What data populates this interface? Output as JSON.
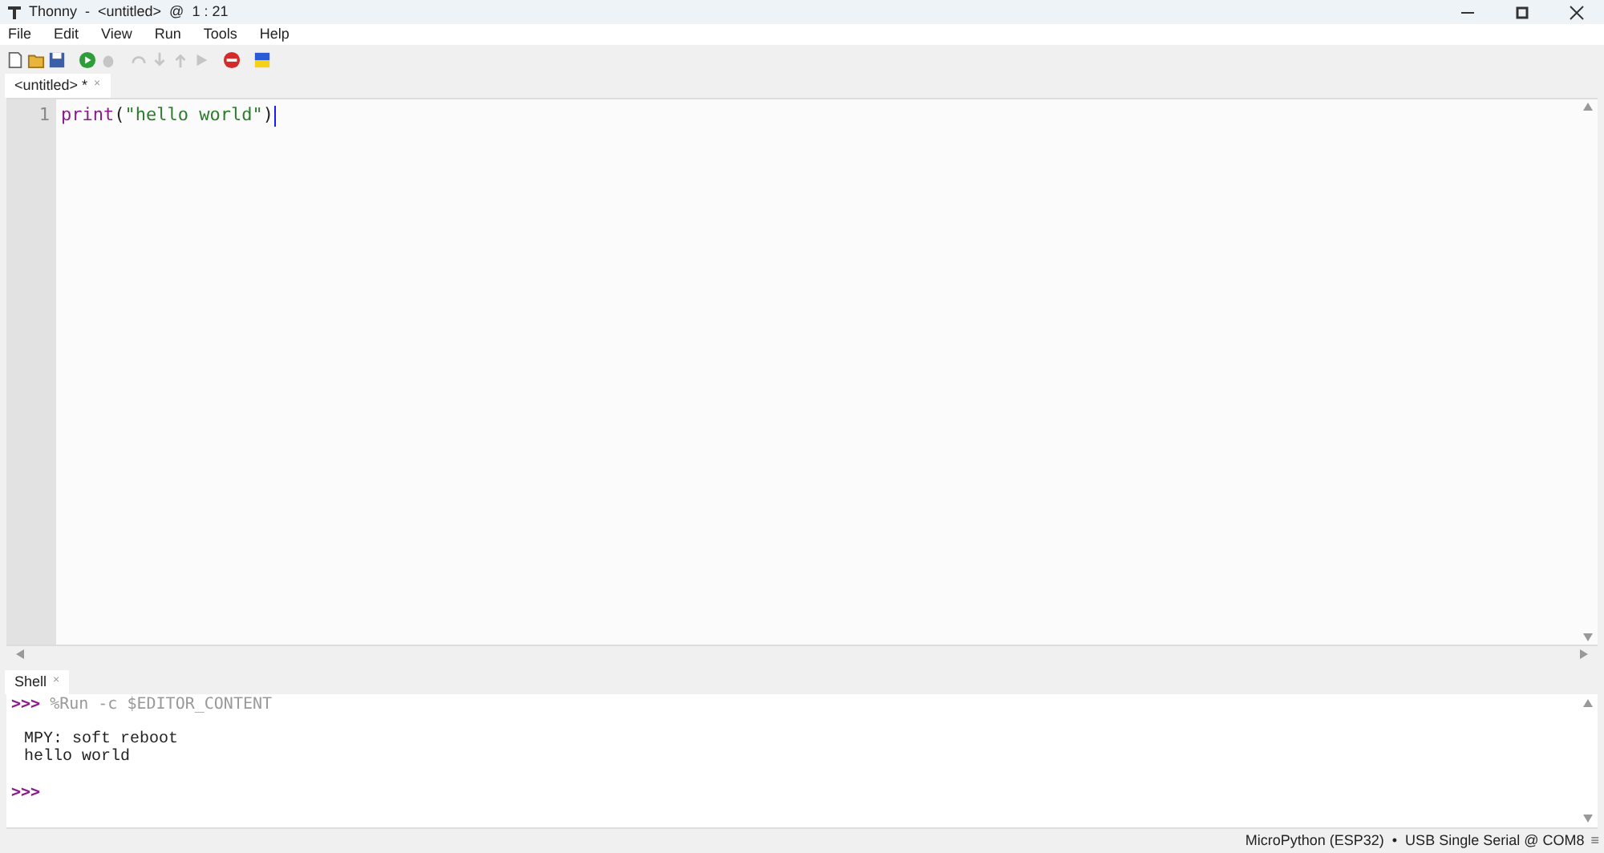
{
  "window": {
    "title": "Thonny  -  <untitled>  @  1 : 21"
  },
  "menu": [
    "File",
    "Edit",
    "View",
    "Run",
    "Tools",
    "Help"
  ],
  "toolbar": [
    {
      "kind": "new",
      "disabled": false
    },
    {
      "kind": "open",
      "disabled": false
    },
    {
      "kind": "save",
      "disabled": false
    },
    {
      "kind": "run",
      "disabled": false
    },
    {
      "kind": "debug",
      "disabled": true
    },
    {
      "kind": "step-over",
      "disabled": true
    },
    {
      "kind": "step-into",
      "disabled": true
    },
    {
      "kind": "step-out",
      "disabled": true
    },
    {
      "kind": "resume",
      "disabled": true
    },
    {
      "kind": "stop",
      "disabled": false
    },
    {
      "kind": "flag",
      "disabled": false
    }
  ],
  "editor_tabs": [
    {
      "label": "<untitled> *",
      "close": "×",
      "selected": true
    }
  ],
  "editor": {
    "lines": [
      {
        "number": "1",
        "tokens": [
          {
            "kind": "builtin",
            "text": "print"
          },
          {
            "kind": "paren",
            "text": "("
          },
          {
            "kind": "string",
            "text": "\"hello world\""
          },
          {
            "kind": "paren",
            "text": ")"
          }
        ]
      }
    ]
  },
  "shell_tabs": [
    {
      "label": "Shell",
      "close": "×",
      "selected": true
    }
  ],
  "shell": {
    "lines": [
      {
        "kind": "command",
        "prompt": ">>>",
        "text": "%Run -c $EDITOR_CONTENT"
      },
      {
        "kind": "blank"
      },
      {
        "kind": "output",
        "text": "MPY: soft reboot"
      },
      {
        "kind": "output",
        "text": "hello world"
      },
      {
        "kind": "blank"
      },
      {
        "kind": "command",
        "prompt": ">>>"
      }
    ]
  },
  "status_bar": {
    "text": "MicroPython (ESP32)  •  USB Single Serial @ COM8",
    "menu": "≡"
  }
}
